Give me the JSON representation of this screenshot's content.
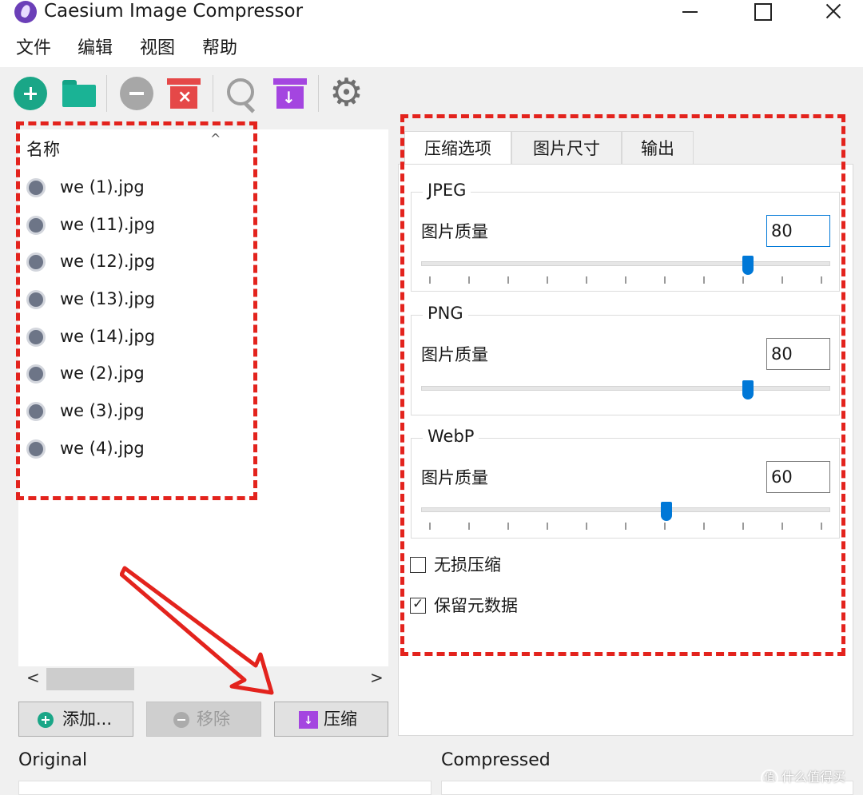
{
  "window": {
    "title": "Caesium Image Compressor"
  },
  "menu": [
    "文件",
    "编辑",
    "视图",
    "帮助"
  ],
  "toolbar": {
    "icons": [
      "add-icon",
      "folder-icon",
      "remove-icon",
      "clear-list-icon",
      "preview-search-icon",
      "compress-icon",
      "settings-gear-icon"
    ],
    "clear_glyph": "×",
    "compress_glyph": "↓"
  },
  "file_list": {
    "column_header": "名称",
    "sort_indicator": "^",
    "files": [
      "we (1).jpg",
      "we (11).jpg",
      "we (12).jpg",
      "we (13).jpg",
      "we (14).jpg",
      "we (2).jpg",
      "we (3).jpg",
      "we (4).jpg"
    ],
    "scroll_left": "<",
    "scroll_right": ">"
  },
  "buttons": {
    "add": "添加...",
    "remove": "移除",
    "compress": "压缩"
  },
  "tabs": [
    "压缩选项",
    "图片尺寸",
    "输出"
  ],
  "active_tab": 0,
  "compression": {
    "jpeg": {
      "title": "JPEG",
      "label": "图片质量",
      "value": "80",
      "level": 80
    },
    "png": {
      "title": "PNG",
      "label": "图片质量",
      "value": "80",
      "level": 80
    },
    "webp": {
      "title": "WebP",
      "label": "图片质量",
      "value": "60",
      "level": 60
    },
    "lossless": {
      "label": "无损压缩",
      "checked": false
    },
    "keep_metadata": {
      "label": "保留元数据",
      "checked": true
    }
  },
  "preview": {
    "original": "Original",
    "compressed": "Compressed"
  },
  "watermark": {
    "logo": "值",
    "text": "什么值得买"
  },
  "colors": {
    "accent": "#0078d7",
    "annotation": "#e3231d",
    "add_green": "#1aa687",
    "compress_purple": "#a445e0",
    "clear_red": "#e54848"
  }
}
